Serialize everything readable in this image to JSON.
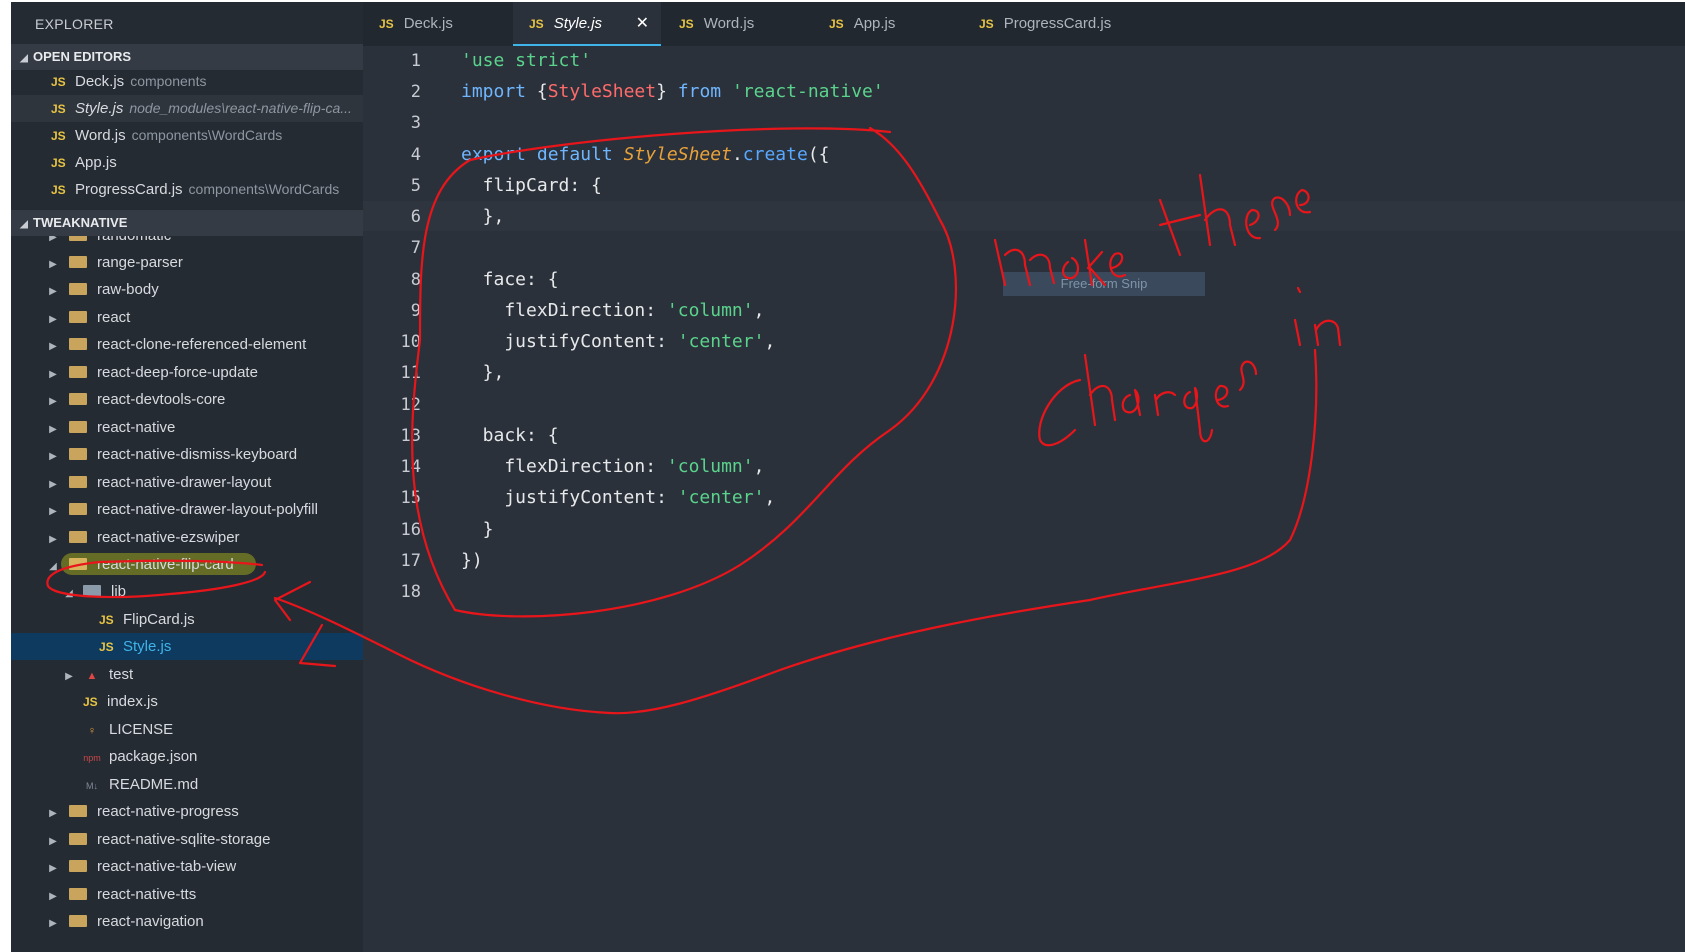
{
  "sidebar": {
    "title": "EXPLORER",
    "open_editors_header": "OPEN EDITORS",
    "project_header": "TWEAKNATIVE",
    "open_editors": [
      {
        "type": "JS",
        "name": "Deck.js",
        "hint": "components"
      },
      {
        "type": "JS",
        "name": "Style.js",
        "hint": "node_modules\\react-native-flip-ca..."
      },
      {
        "type": "JS",
        "name": "Word.js",
        "hint": "components\\WordCards"
      },
      {
        "type": "JS",
        "name": "App.js",
        "hint": ""
      },
      {
        "type": "JS",
        "name": "ProgressCard.js",
        "hint": "components\\WordCards"
      }
    ],
    "tree_top": [
      "randomatic",
      "range-parser",
      "raw-body",
      "react",
      "react-clone-referenced-element",
      "react-deep-force-update",
      "react-devtools-core",
      "react-native",
      "react-native-dismiss-keyboard",
      "react-native-drawer-layout",
      "react-native-drawer-layout-polyfill",
      "react-native-ezswiper"
    ],
    "expanded_folder": "react-native-flip-card",
    "lib_folder": "lib",
    "lib_files": [
      {
        "type": "JS",
        "name": "FlipCard.js"
      },
      {
        "type": "JS",
        "name": "Style.js"
      }
    ],
    "package_files": [
      {
        "name": "test",
        "icon": "test-folder-icon"
      },
      {
        "name": "index.js",
        "icon": "js-icon"
      },
      {
        "name": "LICENSE",
        "icon": "license-icon"
      },
      {
        "name": "package.json",
        "icon": "npm-icon"
      },
      {
        "name": "README.md",
        "icon": "markdown-icon"
      }
    ],
    "tree_bottom": [
      "react-native-progress",
      "react-native-sqlite-storage",
      "react-native-tab-view",
      "react-native-tts",
      "react-navigation"
    ]
  },
  "tabs": [
    {
      "type": "JS",
      "name": "Deck.js"
    },
    {
      "type": "JS",
      "name": "Style.js",
      "close": "✕"
    },
    {
      "type": "JS",
      "name": "Word.js"
    },
    {
      "type": "JS",
      "name": "App.js"
    },
    {
      "type": "JS",
      "name": "ProgressCard.js"
    }
  ],
  "editor": {
    "line_numbers": [
      "1",
      "2",
      "3",
      "4",
      "5",
      "6",
      "7",
      "8",
      "9",
      "10",
      "11",
      "12",
      "13",
      "14",
      "15",
      "16",
      "17",
      "18"
    ],
    "l1": {
      "str": "'use strict'"
    },
    "l2": {
      "kw1": "import",
      "b1": " {",
      "cls": "StyleSheet",
      "b2": "} ",
      "kw2": "from",
      "sp": " ",
      "str": "'react-native'"
    },
    "l4": {
      "kw1": "export",
      "sp1": " ",
      "kw2": "default",
      "sp2": " ",
      "cls": "StyleSheet",
      "dot": ".",
      "fn": "create",
      "rest": "({"
    },
    "l5": "  flipCard: {",
    "l6": "  },",
    "l8": "  face: {",
    "l9": {
      "key": "    flexDirection: ",
      "str": "'column'",
      "end": ","
    },
    "l10": {
      "key": "    justifyContent: ",
      "str": "'center'",
      "end": ","
    },
    "l11": "  },",
    "l13": "  back: {",
    "l14": {
      "key": "    flexDirection: ",
      "str": "'column'",
      "end": ","
    },
    "l15": {
      "key": "    justifyContent: ",
      "str": "'center'",
      "end": ","
    },
    "l16": "  }",
    "l17": "})",
    "snip_label": "Free-form Snip"
  },
  "colors": {
    "annotation": "#e8151b",
    "highlight": "#9ba21a",
    "accent": "#3fb4e8"
  }
}
